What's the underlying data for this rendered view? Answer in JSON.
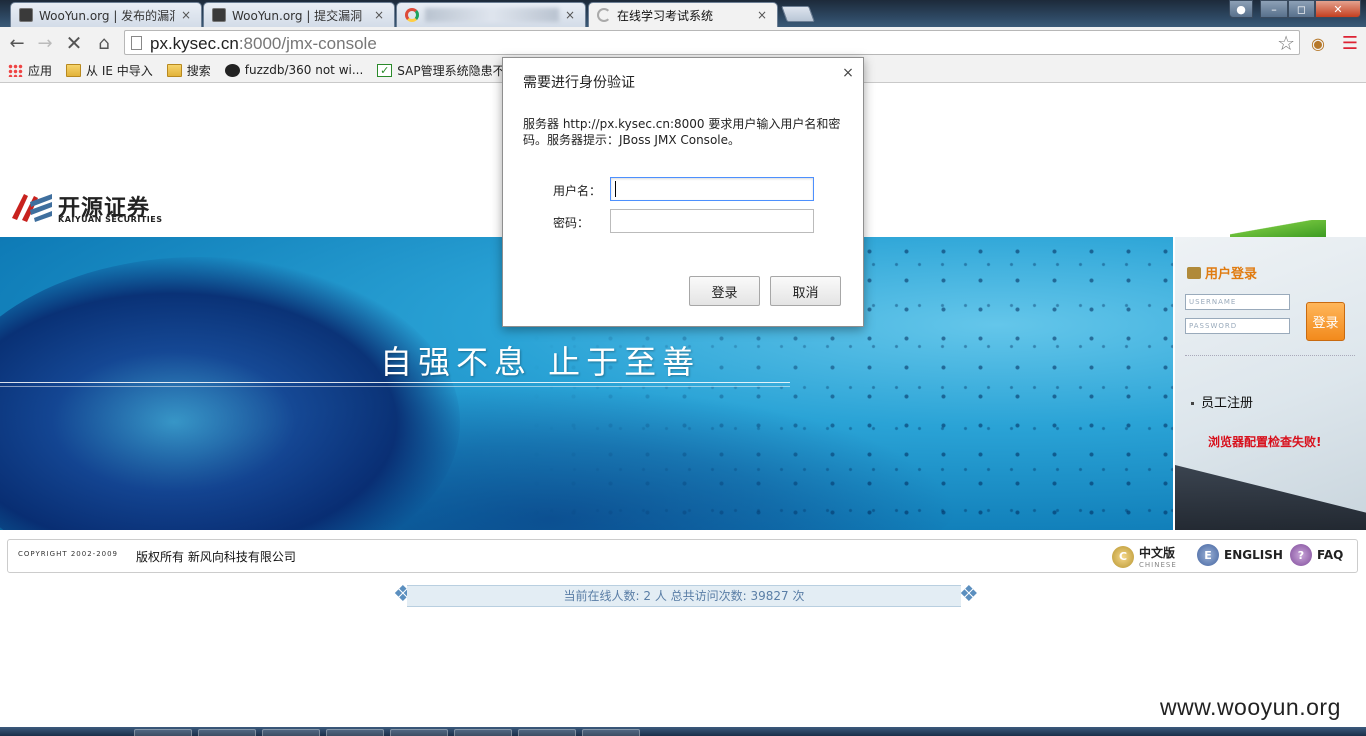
{
  "browser": {
    "tabs": [
      {
        "label": "WooYun.org | 发布的漏洞",
        "favicon": "wooyun-icon"
      },
      {
        "label": "WooYun.org | 提交漏洞",
        "favicon": "wooyun-icon"
      },
      {
        "label": "",
        "favicon": "chrome-icon"
      },
      {
        "label": "在线学习考试系统",
        "favicon": "loading-icon"
      }
    ],
    "close_glyph": "×",
    "url_host": "px.kysec.cn",
    "url_path": ":8000/jmx-console",
    "bookmarks": [
      "应用",
      "从 IE 中导入",
      "搜索",
      "fuzzdb/360 not wi...",
      "SAP管理系统隐患不..."
    ]
  },
  "site": {
    "logo_cn": "开源证券",
    "logo_en": "KAIYUAN SECURITIES",
    "slogan": "自强不息  止于至善",
    "login": {
      "title": "用户登录",
      "username_placeholder": "USERNAME",
      "password_placeholder": "PASSWORD",
      "button": "登录",
      "register": "员工注册",
      "warning": "浏览器配置检查失败!"
    },
    "footer": {
      "copyright": "COPYRIGHT 2002-2009",
      "owner": "版权所有 新风向科技有限公司",
      "lang_cn": "中文版",
      "lang_cn_sub": "CHINESE",
      "lang_en": "ENGLISH",
      "faq": "FAQ"
    },
    "stats": "当前在线人数: 2 人 总共访问次数: 39827 次"
  },
  "dialog": {
    "title": "需要进行身份验证",
    "message": "服务器 http://px.kysec.cn:8000 要求用户输入用户名和密码。服务器提示：JBoss JMX Console。",
    "username_label": "用户名：",
    "password_label": "密码：",
    "login_button": "登录",
    "cancel_button": "取消",
    "close_glyph": "×"
  },
  "watermark": "www.wooyun.org",
  "colors": {
    "accent_orange": "#e07b10",
    "warning_red": "#d8101c",
    "banner_blue": "#2aa3d6"
  }
}
